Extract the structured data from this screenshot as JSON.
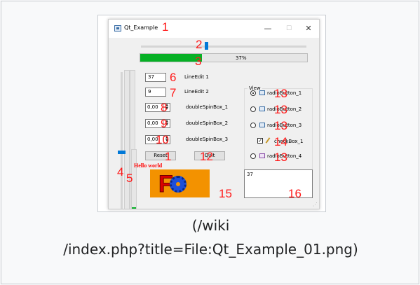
{
  "caption": {
    "line1": "(/wiki",
    "line2": "/index.php?title=File:Qt_Example_01.png)"
  },
  "window": {
    "title": "Qt_Example",
    "controls": {
      "minimize": "—",
      "maximize": "☐",
      "close": "✕"
    }
  },
  "annotations": {
    "n1a": "1",
    "n2": "2",
    "n3": "3",
    "n4": "4",
    "n5": "5",
    "n6": "6",
    "n7": "7",
    "n8": "8",
    "n9": "9",
    "n10": "10",
    "n1b": "1",
    "n12": "12",
    "n13a": "13",
    "n13b": "13",
    "n13c": "13",
    "n14": "14",
    "n13d": "13",
    "n15": "15",
    "n16": "16"
  },
  "slider": {
    "value_fraction": 0.39
  },
  "progress": {
    "text": "37%",
    "value": 37
  },
  "form": {
    "lineedit1": {
      "value": "37",
      "label": "LineEdit 1"
    },
    "lineedit2": {
      "value": "9",
      "label": "LineEdit 2"
    },
    "spin1": {
      "value": "0,00",
      "label": "doubleSpinBox_1"
    },
    "spin2": {
      "value": "0,00",
      "label": "doubleSpinBox_2"
    },
    "spin3": {
      "value": "0,00",
      "label": "doubleSpinBox_3"
    },
    "reset_label": "Reset",
    "quit_label": "Quit",
    "hello": "Hello world"
  },
  "view_group": {
    "title": "View",
    "radio1": "radioButton_1",
    "radio2": "radioButton_2",
    "radio3": "radioButton_3",
    "check1": "checkBox_1",
    "radio4": "radioButton_4"
  },
  "textedit": {
    "value": "37"
  },
  "icons": {
    "app": "qt-app-icon",
    "radio_icon": "window-icon",
    "pencil": "pencil-icon",
    "logo": "freecad-logo-icon",
    "grip": "resize-grip-icon"
  },
  "colors": {
    "progress_green": "#06b025",
    "slider_blue": "#0078d7",
    "annotation_red": "#ff1a1a",
    "logo_orange": "#f39200"
  }
}
